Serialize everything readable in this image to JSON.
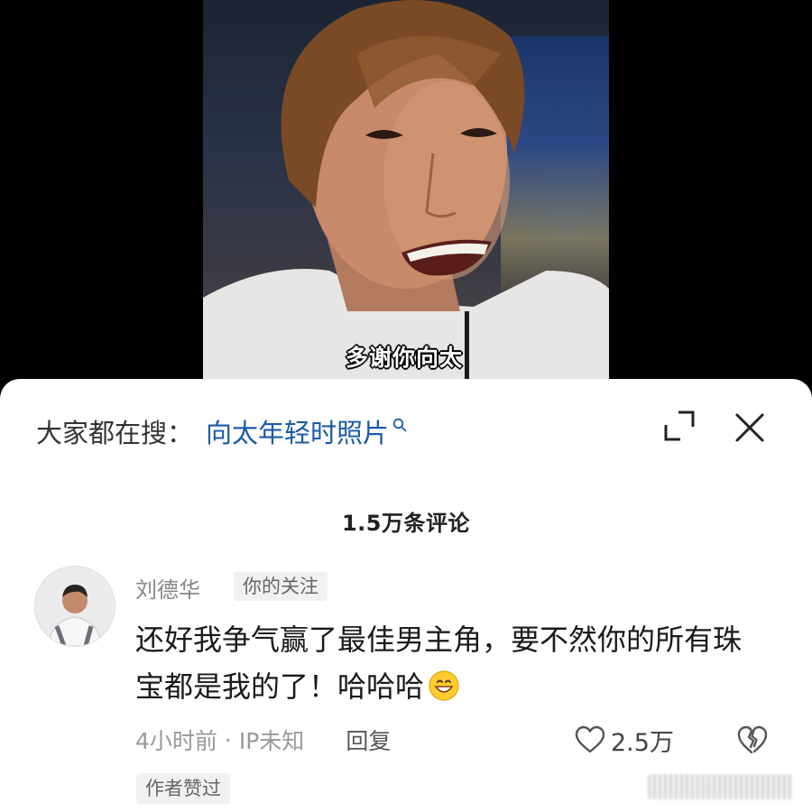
{
  "video": {
    "subtitle": "多谢你向太"
  },
  "search_bar": {
    "prefix": "大家都在搜：",
    "term": "向太年轻时照片"
  },
  "comments_header": {
    "count_label": "1.5万条评论"
  },
  "comment": {
    "username": "刘德华",
    "badge": "你的关注",
    "text": "还好我争气赢了最佳男主角，要不然你的所有珠宝都是我的了！哈哈哈",
    "emoji": "grinning-face",
    "time": "4小时前",
    "separator": "·",
    "ip": "IP未知",
    "reply_label": "回复",
    "like_count": "2.5万",
    "author_liked": "作者赞过"
  },
  "colors": {
    "search_term": "#1b5aa6",
    "meta_text": "#999999",
    "badge_bg": "#f1f1f1"
  },
  "icons": [
    "search-icon",
    "expand-icon",
    "close-icon",
    "heart-icon",
    "broken-heart-icon"
  ]
}
